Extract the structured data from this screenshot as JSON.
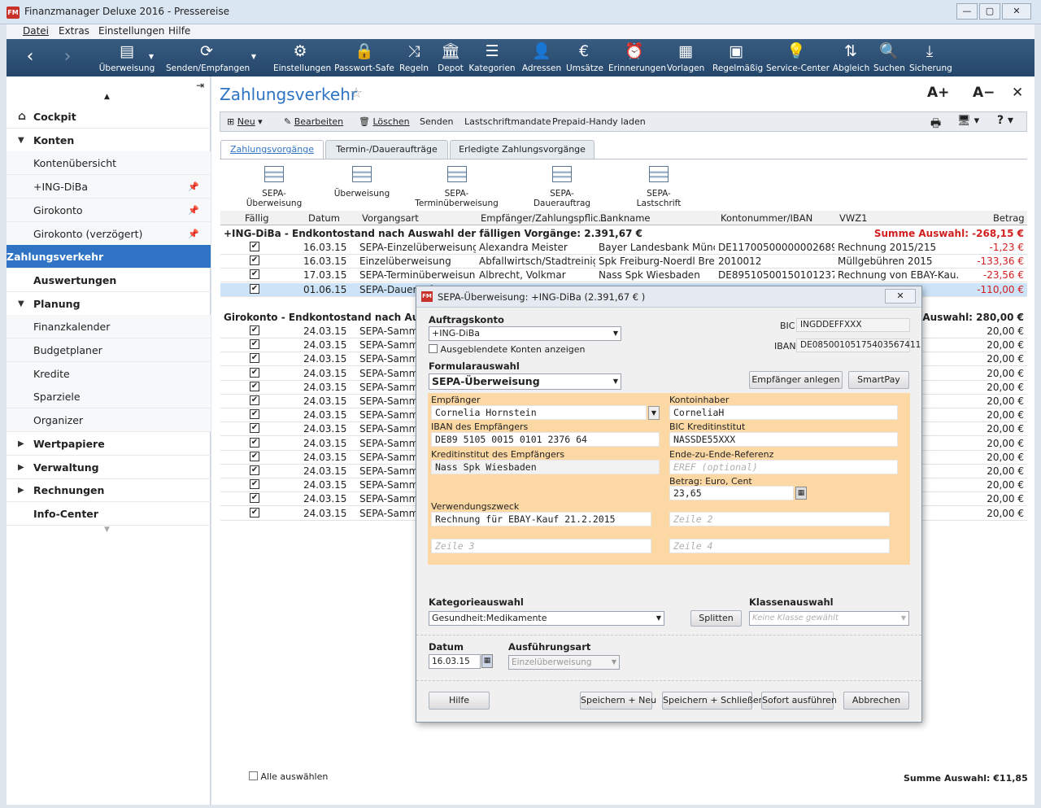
{
  "window": {
    "title": "Finanzmanager Deluxe 2016 - Pressereise",
    "logo": "FM"
  },
  "menu": [
    "Datei",
    "Extras",
    "Einstellungen",
    "Hilfe"
  ],
  "toolbar": [
    {
      "label": "Überweisung",
      "icon": "transfer-icon",
      "glyph": "▤"
    },
    {
      "label": "Senden/Empfangen",
      "icon": "sync-icon",
      "glyph": "⟳"
    },
    {
      "label": "Einstellungen",
      "icon": "gear-icon",
      "glyph": "⚙"
    },
    {
      "label": "Passwort-Safe",
      "icon": "lock-icon",
      "glyph": "🔒"
    },
    {
      "label": "Regeln",
      "icon": "shuffle-icon",
      "glyph": "⤨"
    },
    {
      "label": "Depot",
      "icon": "bank-icon",
      "glyph": "🏛"
    },
    {
      "label": "Kategorien",
      "icon": "categories-icon",
      "glyph": "☰"
    },
    {
      "label": "Adressen",
      "icon": "person-icon",
      "glyph": "👤"
    },
    {
      "label": "Umsätze",
      "icon": "money-bag-icon",
      "glyph": "€"
    },
    {
      "label": "Erinnerungen",
      "icon": "alarm-clock-icon",
      "glyph": "⏰"
    },
    {
      "label": "Vorlagen",
      "icon": "template-icon",
      "glyph": "▦"
    },
    {
      "label": "Regelmäßig",
      "icon": "recurring-icon",
      "glyph": "▣"
    },
    {
      "label": "Service-Center",
      "icon": "lightbulb-icon",
      "glyph": "💡"
    },
    {
      "label": "Abgleich",
      "icon": "compare-icon",
      "glyph": "⇅"
    },
    {
      "label": "Suchen",
      "icon": "search-icon",
      "glyph": "🔍"
    },
    {
      "label": "Sicherung",
      "icon": "download-icon",
      "glyph": "⤓"
    }
  ],
  "sidebar": [
    {
      "label": "Cockpit",
      "type": "h",
      "icon": "home"
    },
    {
      "label": "Konten",
      "type": "h",
      "tri": "▼"
    },
    {
      "label": "Kontenübersicht",
      "type": "c"
    },
    {
      "label": "+ING-DiBa",
      "type": "c",
      "pin": true
    },
    {
      "label": "Girokonto",
      "type": "c",
      "pin": true
    },
    {
      "label": "Girokonto (verzögert)",
      "type": "c",
      "pin": true
    },
    {
      "label": "Zahlungsverkehr",
      "type": "active"
    },
    {
      "label": "Auswertungen",
      "type": "h"
    },
    {
      "label": "Planung",
      "type": "h",
      "tri": "▼"
    },
    {
      "label": "Finanzkalender",
      "type": "c"
    },
    {
      "label": "Budgetplaner",
      "type": "c"
    },
    {
      "label": "Kredite",
      "type": "c"
    },
    {
      "label": "Sparziele",
      "type": "c"
    },
    {
      "label": "Organizer",
      "type": "c"
    },
    {
      "label": "Wertpapiere",
      "type": "h",
      "tri": "▶"
    },
    {
      "label": "Verwaltung",
      "type": "h",
      "tri": "▶"
    },
    {
      "label": "Rechnungen",
      "type": "h",
      "tri": "▶"
    },
    {
      "label": "Info-Center",
      "type": "h"
    }
  ],
  "main": {
    "title": "Zahlungsverkehr",
    "font_plus": "A+",
    "font_minus": "A−",
    "actions": [
      "Neu",
      "Bearbeiten",
      "Löschen",
      "Senden",
      "Lastschriftmandate",
      "Prepaid-Handy laden"
    ],
    "tabs": [
      "Zahlungsvorgänge",
      "Termin-/Daueraufträge",
      "Erledigte Zahlungsvorgänge"
    ],
    "forms": [
      "SEPA-Überweisung",
      "Überweisung",
      "SEPA-Terminüberweisung",
      "SEPA-Dauerauftrag",
      "SEPA-Lastschrift"
    ],
    "columns": [
      "Fällig",
      "Datum",
      "Vorgangsart",
      "Empfänger/Zahlungspflic...",
      "Bankname",
      "Kontonummer/IBAN",
      "VWZ1",
      "Betrag"
    ],
    "group1": {
      "label": "+ING-DiBa - Endkontostand nach Auswahl der fälligen Vorgänge: 2.391,67 €",
      "sum": "Summe Auswahl: -268,15 €"
    },
    "rows1": [
      {
        "date": "16.03.15",
        "type": "SEPA-Einzelüberweisung",
        "payee": "Alexandra Meister",
        "bank": "Bayer Landesbank Münc...",
        "iban": "DE11700500000002689...",
        "vwz": "Rechnung 2015/215",
        "amount": "-1,23 €"
      },
      {
        "date": "16.03.15",
        "type": "Einzelüberweisung",
        "payee": "Abfallwirtsch/Stadtreinig.",
        "bank": "Spk Freiburg-Noerdl Breisga",
        "iban": "2010012",
        "vwz": "Müllgebühren 2015",
        "amount": "-133,36 €"
      },
      {
        "date": "17.03.15",
        "type": "SEPA-Terminüberweisun...",
        "payee": "Albrecht, Volkmar",
        "bank": "Nass Spk Wiesbaden",
        "iban": "DE89510500150101237...",
        "vwz": "Rechnung von EBAY-Kau...",
        "amount": "-23,56 €"
      },
      {
        "date": "01.06.15",
        "type": "SEPA-Dauerauftrag",
        "payee": "",
        "bank": "",
        "iban": "",
        "vwz": "",
        "amount": "-110,00 €"
      }
    ],
    "group2": {
      "label": "Girokonto - Endkontostand nach Auswahl der fälligen Vorgänge",
      "sum": "Summe Auswahl: 280,00 €"
    },
    "rows2_date": "24.03.15",
    "rows2_type": "SEPA-Sammelüberweisung",
    "rows2_amount": "20,00 €",
    "select_all": "Alle auswählen",
    "footer_sum": "Summe Auswahl: €11,85"
  },
  "dialog": {
    "title": "SEPA-Überweisung: +ING-DiBa (2.391,67 € )",
    "auftragskonto_label": "Auftragskonto",
    "auftragskonto": "+ING-DiBa",
    "hidden_accounts": "Ausgeblendete Konten anzeigen",
    "bic_label": "BIC",
    "bic": "INGDDEFFXXX",
    "iban_label": "IBAN",
    "iban": "DE08500105175403567411",
    "form_label": "Formularauswahl",
    "form": "SEPA-Überweisung",
    "btn_payee": "Empfänger anlegen",
    "btn_smartpay": "SmartPay",
    "empf_label": "Empfänger",
    "empf": "Cornelia Hornstein",
    "inhaber_label": "Kontoinhaber",
    "inhaber": "CorneliaH",
    "iban_empf_label": "IBAN des Empfängers",
    "iban_empf": "DE89 5105 0015 0101 2376 64",
    "bic_kred_label": "BIC Kreditinstitut",
    "bic_kred": "NASSDE55XXX",
    "kred_label": "Kreditinstitut des Empfängers",
    "kred": "Nass Spk Wiesbaden",
    "e2e_label": "Ende-zu-Ende-Referenz",
    "e2e_ph": "EREF (optional)",
    "betrag_label": "Betrag: Euro, Cent",
    "betrag": "23,65",
    "vwz_label": "Verwendungszweck",
    "vwz1": "Rechnung für EBAY-Kauf 21.2.2015",
    "zeile2": "Zeile 2",
    "zeile3": "Zeile 3",
    "zeile4": "Zeile 4",
    "kat_label": "Kategorieauswahl",
    "kat": "Gesundheit:Medikamente",
    "btn_split": "Splitten",
    "klasse_label": "Klassenauswahl",
    "klasse_ph": "Keine Klasse gewählt",
    "datum_label": "Datum",
    "datum": "16.03.15",
    "art_label": "Ausführungsart",
    "art": "Einzelüberweisung",
    "btn_help": "Hilfe",
    "btn_save_new": "Speichern + Neu",
    "btn_save_close": "Speichern + Schließen",
    "btn_exec": "Sofort ausführen",
    "btn_cancel": "Abbrechen"
  },
  "colors": {
    "accent": "#2f74c4",
    "toolbar": "#2d5075",
    "negative": "#d21f1f",
    "form_bg": "#fcd8a4"
  }
}
